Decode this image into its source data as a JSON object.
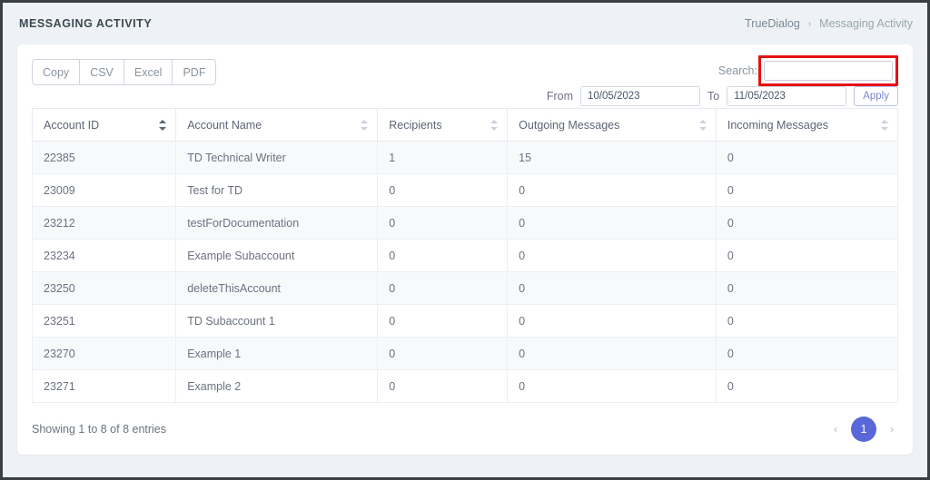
{
  "header": {
    "title": "MESSAGING ACTIVITY",
    "breadcrumb": {
      "root": "TrueDialog",
      "separator": "›",
      "current": "Messaging Activity"
    }
  },
  "toolbar": {
    "export_buttons": [
      {
        "label": "Copy"
      },
      {
        "label": "CSV"
      },
      {
        "label": "Excel"
      },
      {
        "label": "PDF"
      }
    ],
    "search": {
      "label": "Search:",
      "value": "",
      "placeholder": "",
      "highlight_color": "#e51111"
    },
    "date_filter": {
      "from_label": "From",
      "from_value": "10/05/2023",
      "to_label": "To",
      "to_value": "11/05/2023",
      "apply_label": "Apply"
    }
  },
  "table": {
    "columns": [
      {
        "label": "Account ID",
        "sort": "active"
      },
      {
        "label": "Account Name",
        "sort": "none"
      },
      {
        "label": "Recipients",
        "sort": "none"
      },
      {
        "label": "Outgoing Messages",
        "sort": "none"
      },
      {
        "label": "Incoming Messages",
        "sort": "none"
      }
    ],
    "rows": [
      {
        "account_id": "22385",
        "account_name": "TD Technical Writer",
        "recipients": "1",
        "outgoing": "15",
        "incoming": "0"
      },
      {
        "account_id": "23009",
        "account_name": "Test for TD",
        "recipients": "0",
        "outgoing": "0",
        "incoming": "0"
      },
      {
        "account_id": "23212",
        "account_name": "testForDocumentation",
        "recipients": "0",
        "outgoing": "0",
        "incoming": "0"
      },
      {
        "account_id": "23234",
        "account_name": "Example Subaccount",
        "recipients": "0",
        "outgoing": "0",
        "incoming": "0"
      },
      {
        "account_id": "23250",
        "account_name": "deleteThisAccount",
        "recipients": "0",
        "outgoing": "0",
        "incoming": "0"
      },
      {
        "account_id": "23251",
        "account_name": "TD Subaccount 1",
        "recipients": "0",
        "outgoing": "0",
        "incoming": "0"
      },
      {
        "account_id": "23270",
        "account_name": "Example 1",
        "recipients": "0",
        "outgoing": "0",
        "incoming": "0"
      },
      {
        "account_id": "23271",
        "account_name": "Example 2",
        "recipients": "0",
        "outgoing": "0",
        "incoming": "0"
      }
    ]
  },
  "footer": {
    "entries_info": "Showing 1 to 8 of 8 entries",
    "pagination": {
      "prev": "‹",
      "next": "›",
      "pages": [
        {
          "label": "1",
          "active": true
        }
      ],
      "active_color": "#5a67d8"
    }
  }
}
